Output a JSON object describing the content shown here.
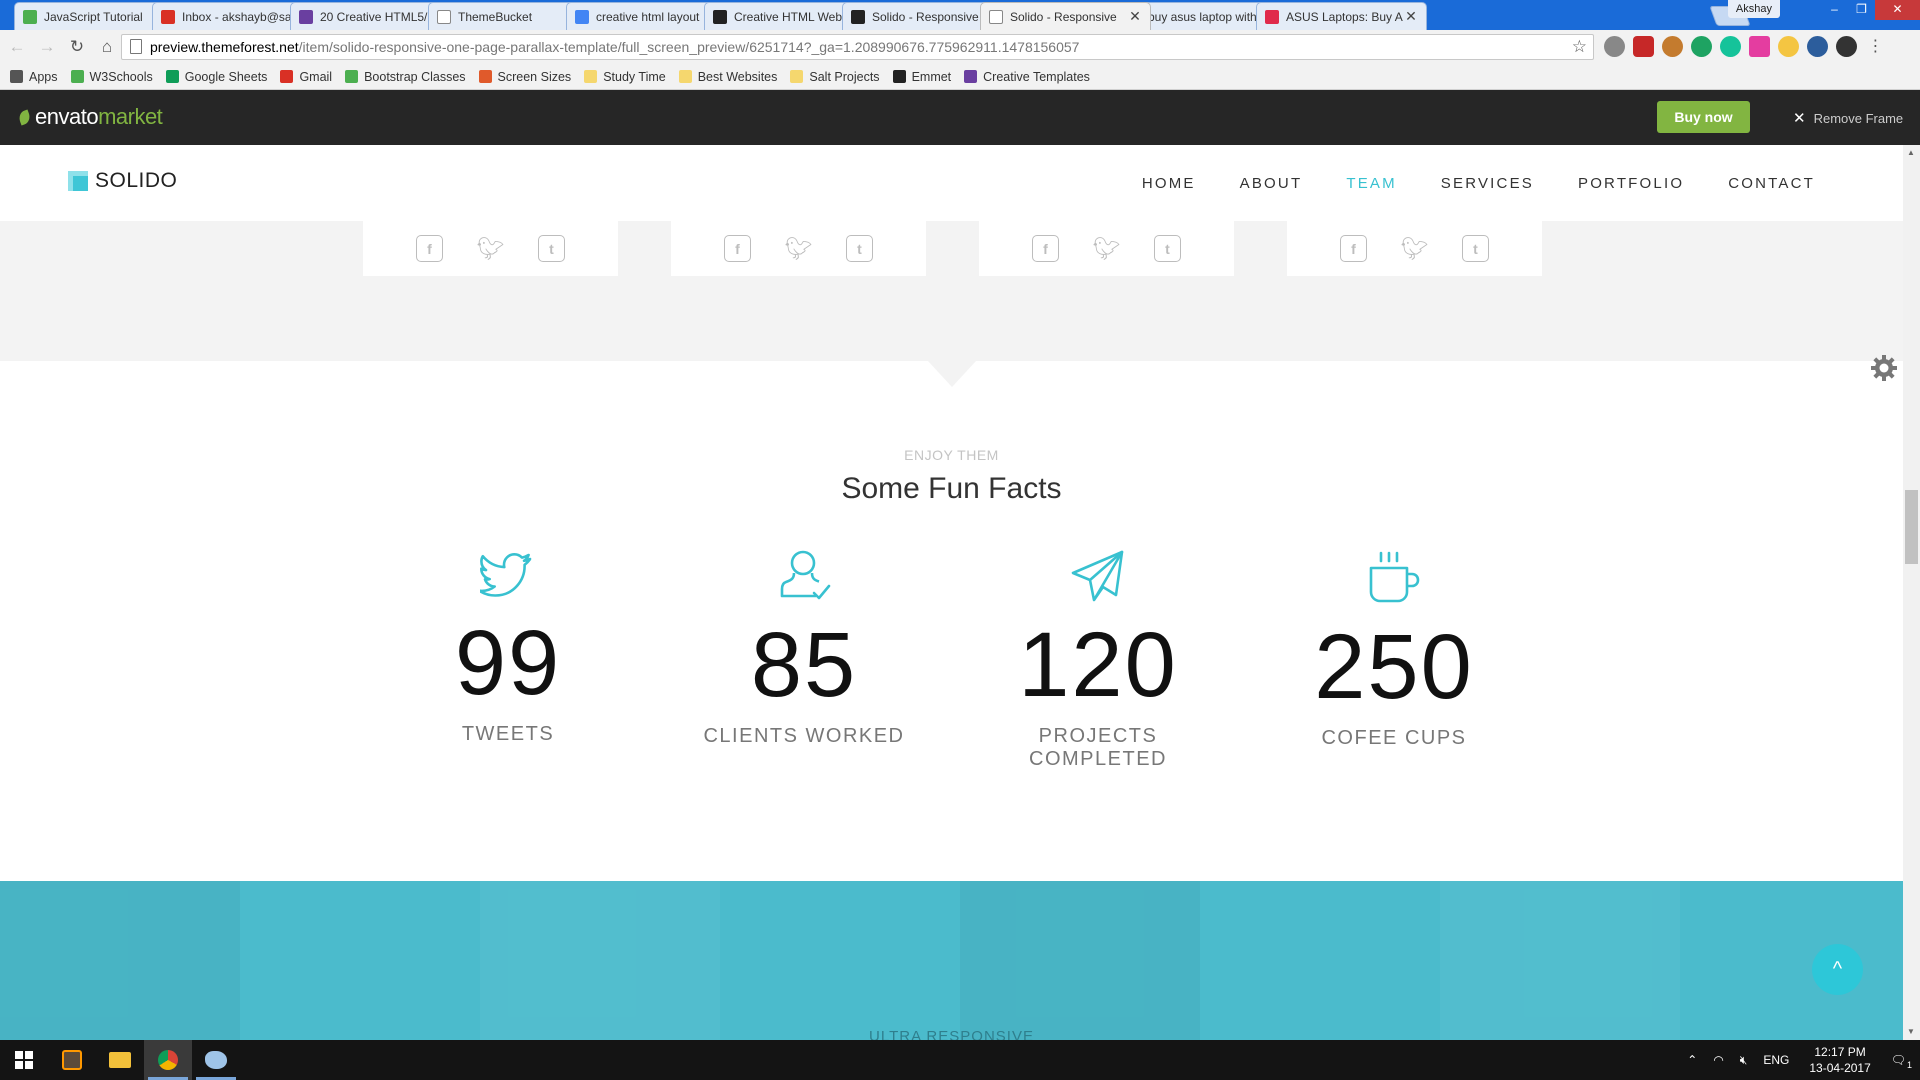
{
  "browser": {
    "tabs": [
      {
        "label": "JavaScript Tutorial",
        "color": "#4caf50",
        "active": false
      },
      {
        "label": "Inbox - akshayb@sa",
        "color": "#d93025",
        "active": false
      },
      {
        "label": "20 Creative HTML5/",
        "color": "#6a3fa0",
        "active": false
      },
      {
        "label": "ThemeBucket",
        "color": "#ffffff",
        "active": false
      },
      {
        "label": "creative html layout",
        "color": "#4285f4",
        "active": false
      },
      {
        "label": "Creative HTML Web",
        "color": "#222222",
        "active": false
      },
      {
        "label": "Solido - Responsive",
        "color": "#222222",
        "active": false
      },
      {
        "label": "Solido - Responsive",
        "color": "#ffffff",
        "active": true
      },
      {
        "label": "buy asus laptop with",
        "color": "#4285f4",
        "active": false
      },
      {
        "label": "ASUS Laptops: Buy A",
        "color": "#e02a4b",
        "active": false
      }
    ],
    "profile_name": "Akshay",
    "url_host": "preview.themeforest.net",
    "url_path": "/item/solido-responsive-one-page-parallax-template/full_screen_preview/6251714?_ga=1.208990676.775962911.1478156057",
    "bookmarks": [
      {
        "label": "Apps",
        "color": "#555555"
      },
      {
        "label": "W3Schools",
        "color": "#4caf50"
      },
      {
        "label": "Google Sheets",
        "color": "#0f9d58"
      },
      {
        "label": "Gmail",
        "color": "#d93025"
      },
      {
        "label": "Bootstrap Classes",
        "color": "#4caf50"
      },
      {
        "label": "Screen Sizes",
        "color": "#e05a2b"
      },
      {
        "label": "Study Time",
        "color": "#f5d76e"
      },
      {
        "label": "Best Websites",
        "color": "#f5d76e"
      },
      {
        "label": "Salt Projects",
        "color": "#f5d76e"
      },
      {
        "label": "Emmet",
        "color": "#222222"
      },
      {
        "label": "Creative Templates",
        "color": "#6a3fa0"
      }
    ]
  },
  "envato": {
    "logo_left": "envato",
    "logo_right": "market",
    "buy_now": "Buy now",
    "remove_frame": "Remove Frame"
  },
  "site": {
    "logo": "SOLIDO",
    "menu": [
      {
        "label": "HOME",
        "active": false
      },
      {
        "label": "ABOUT",
        "active": false
      },
      {
        "label": "TEAM",
        "active": true
      },
      {
        "label": "SERVICES",
        "active": false
      },
      {
        "label": "PORTFOLIO",
        "active": false
      },
      {
        "label": "CONTACT",
        "active": false
      }
    ],
    "social_icons": [
      "facebook-icon",
      "twitter-icon",
      "tumblr-icon"
    ]
  },
  "fun_facts": {
    "eyebrow": "ENJOY THEM",
    "title": "Some Fun Facts",
    "items": [
      {
        "icon": "twitter-bird-icon",
        "number": "99",
        "label": "TWEETS"
      },
      {
        "icon": "user-check-icon",
        "number": "85",
        "label": "CLIENTS WORKED"
      },
      {
        "icon": "paper-plane-icon",
        "number": "120",
        "label": "PROJECTS COMPLETED"
      },
      {
        "icon": "coffee-cup-icon",
        "number": "250",
        "label": "COFEE CUPS"
      }
    ]
  },
  "next_section": {
    "label": "ULTRA RESPONSIVE",
    "to_top": "^"
  },
  "accent_color": "#38c1d0",
  "taskbar": {
    "lang": "ENG",
    "time": "12:17 PM",
    "date": "13-04-2017",
    "notification_count": "1"
  }
}
